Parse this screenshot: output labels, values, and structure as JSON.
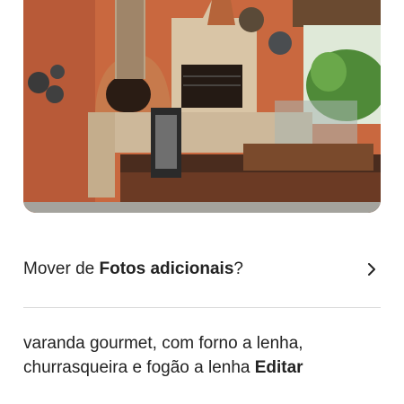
{
  "photo": {
    "alt": "varanda gourmet, com forno a lenha, churrasqueira e fogão a lenha"
  },
  "move": {
    "prefix": "Mover de ",
    "album": "Fotos adicionais",
    "suffix": "?",
    "icon": "chevron-right-icon"
  },
  "caption": {
    "text": "varanda gourmet, com forno a lenha, churrasqueira e fogão a lenha ",
    "edit_label": "Editar"
  }
}
